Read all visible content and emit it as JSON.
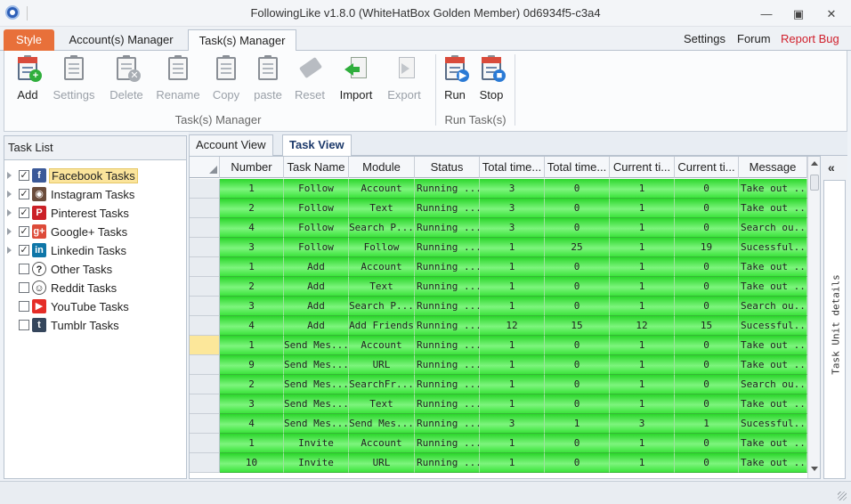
{
  "window": {
    "title": "FollowingLike v1.8.0 (WhiteHatBox Golden Member) 0d6934f5-c3a4",
    "minimize": "▫",
    "restore": "◫",
    "close": "✕"
  },
  "menu": {
    "style_label": "Style",
    "tabs": [
      {
        "label": "Account(s) Manager"
      },
      {
        "label": "Task(s) Manager"
      }
    ],
    "links": {
      "settings": "Settings",
      "forum": "Forum",
      "report_bug": "Report Bug"
    }
  },
  "ribbon": {
    "buttons": [
      {
        "label": "Add",
        "icon": "add-task-icon"
      },
      {
        "label": "Settings",
        "icon": "task-settings-icon"
      },
      {
        "label": "Delete",
        "icon": "delete-task-icon"
      },
      {
        "label": "Rename",
        "icon": "rename-task-icon"
      },
      {
        "label": "Copy",
        "icon": "copy-task-icon"
      },
      {
        "label": "paste",
        "icon": "paste-task-icon"
      },
      {
        "label": "Reset",
        "icon": "reset-eraser-icon"
      },
      {
        "label": "Import",
        "icon": "import-icon"
      },
      {
        "label": "Export",
        "icon": "export-icon"
      },
      {
        "label": "Run",
        "icon": "run-icon"
      },
      {
        "label": "Stop",
        "icon": "stop-icon"
      }
    ],
    "groups": {
      "task_manager": "Task(s) Manager",
      "run_tasks": "Run Task(s)"
    }
  },
  "task_list": {
    "header": "Task List",
    "items": [
      {
        "label": "Facebook Tasks",
        "checked": "✓",
        "icon": "f",
        "color": "#3b5998"
      },
      {
        "label": "Instagram Tasks",
        "checked": "✓",
        "icon": "◉",
        "color": "#6b4c3b"
      },
      {
        "label": "Pinterest Tasks",
        "checked": "✓",
        "icon": "P",
        "color": "#cb2027"
      },
      {
        "label": "Google+ Tasks",
        "checked": "✓",
        "icon": "g+",
        "color": "#dd4b39"
      },
      {
        "label": "Linkedin Tasks",
        "checked": "✓",
        "icon": "in",
        "color": "#0e76a8"
      },
      {
        "label": "Other Tasks",
        "checked": "",
        "icon": "?",
        "color": "#ffffff"
      },
      {
        "label": "Reddit Tasks",
        "checked": "",
        "icon": "☺",
        "color": "#ffffff"
      },
      {
        "label": "YouTube Tasks",
        "checked": "",
        "icon": "▶",
        "color": "#e52d27"
      },
      {
        "label": "Tumblr Tasks",
        "checked": "",
        "icon": "t",
        "color": "#35465c"
      }
    ]
  },
  "views": {
    "account_view": "Account View",
    "task_view": "Task View"
  },
  "grid": {
    "columns": [
      "Number",
      "Task Name",
      "Module",
      "Status",
      "Total time...",
      "Total time...",
      "Current ti...",
      "Current ti...",
      "Message"
    ],
    "rows": [
      [
        "1",
        "Follow",
        "Account",
        "Running ...",
        "3",
        "0",
        "1",
        "0",
        "Take out ..."
      ],
      [
        "2",
        "Follow",
        "Text",
        "Running ...",
        "3",
        "0",
        "1",
        "0",
        "Take out ..."
      ],
      [
        "4",
        "Follow",
        "Search P...",
        "Running ...",
        "3",
        "0",
        "1",
        "0",
        "Search ou..."
      ],
      [
        "3",
        "Follow",
        "Follow",
        "Running ...",
        "1",
        "25",
        "1",
        "19",
        "Sucessful..."
      ],
      [
        "1",
        "Add",
        "Account",
        "Running ...",
        "1",
        "0",
        "1",
        "0",
        "Take out ..."
      ],
      [
        "2",
        "Add",
        "Text",
        "Running ...",
        "1",
        "0",
        "1",
        "0",
        "Take out ..."
      ],
      [
        "3",
        "Add",
        "Search P...",
        "Running ...",
        "1",
        "0",
        "1",
        "0",
        "Search ou..."
      ],
      [
        "4",
        "Add",
        "Add Friends",
        "Running ...",
        "12",
        "15",
        "12",
        "15",
        "Sucessful..."
      ],
      [
        "1",
        "Send Mes...",
        "Account",
        "Running ...",
        "1",
        "0",
        "1",
        "0",
        "Take out ..."
      ],
      [
        "9",
        "Send Mes...",
        "URL",
        "Running ...",
        "1",
        "0",
        "1",
        "0",
        "Take out ..."
      ],
      [
        "2",
        "Send Mes...",
        "SearchFr...",
        "Running ...",
        "1",
        "0",
        "1",
        "0",
        "Search ou..."
      ],
      [
        "3",
        "Send Mes...",
        "Text",
        "Running ...",
        "1",
        "0",
        "1",
        "0",
        "Take out ..."
      ],
      [
        "4",
        "Send Mes...",
        "Send Mes...",
        "Running ...",
        "3",
        "1",
        "3",
        "1",
        "Sucessful..."
      ],
      [
        "1",
        "Invite",
        "Account",
        "Running ...",
        "1",
        "0",
        "1",
        "0",
        "Take out ..."
      ],
      [
        "10",
        "Invite",
        "URL",
        "Running ...",
        "1",
        "0",
        "1",
        "0",
        "Take out ..."
      ]
    ],
    "current_row_index": 8
  },
  "side_panel": {
    "collapse": "«",
    "label": "Task Unit details"
  }
}
